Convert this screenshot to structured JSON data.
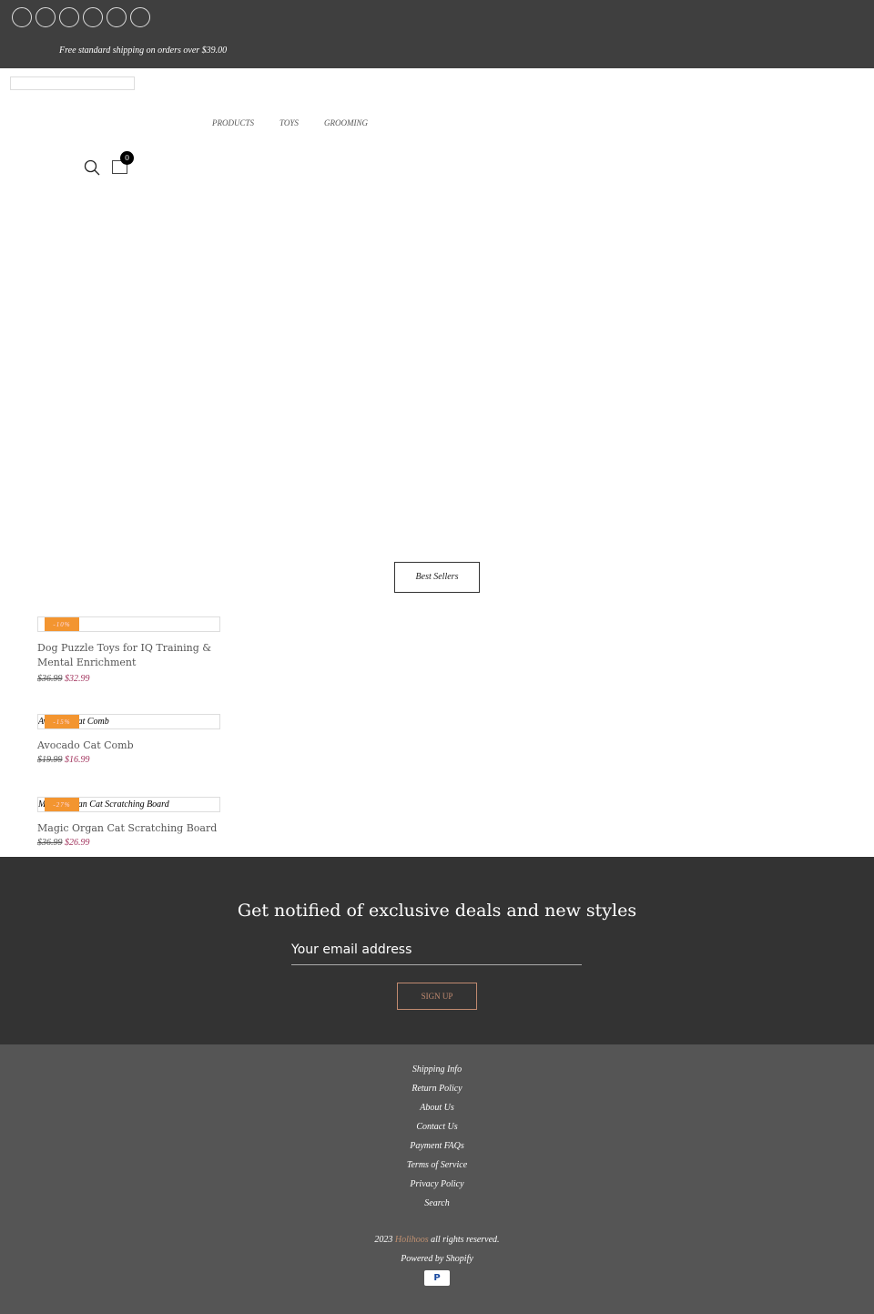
{
  "header": {
    "social_icons": [
      "social-icon-1",
      "social-icon-2",
      "social-icon-3",
      "social-icon-4",
      "social-icon-5",
      "social-icon-6"
    ],
    "shipping_banner": "Free standard shipping on orders over $39.00",
    "nav": [
      "PRODUCTS",
      "TOYS",
      "GROOMING"
    ],
    "cart_count": "0"
  },
  "section": {
    "best_sellers": "Best Sellers"
  },
  "products": [
    {
      "image_alt": "",
      "discount": "-10%",
      "title": "Dog Puzzle Toys for IQ Training & Mental Enrichment",
      "old_price": "$36.99",
      "price": "$32.99"
    },
    {
      "image_alt": "Avocado Cat Comb",
      "discount": "-15%",
      "title": "Avocado Cat Comb",
      "old_price": "$19.99",
      "price": "$16.99"
    },
    {
      "image_alt": "Magic Organ Cat Scratching Board",
      "discount": "-27%",
      "title": "Magic Organ Cat Scratching Board",
      "old_price": "$36.99",
      "price": "$26.99"
    }
  ],
  "newsletter": {
    "heading": "Get notified of exclusive deals and new styles",
    "placeholder": "Your email address",
    "button": "SIGN UP"
  },
  "footer": {
    "links": [
      "Shipping Info",
      "Return Policy",
      "About Us",
      "Contact Us",
      "Payment FAQs",
      "Terms of Service",
      "Privacy Policy",
      "Search"
    ],
    "year": "2023",
    "brand": "Holihoos",
    "rights": "all rights reserved.",
    "powered": "Powered by Shopify",
    "payment": "P"
  },
  "colors": {
    "discount": "#f39530",
    "sale_price": "#a0305a",
    "topbar": "#3f3f3f",
    "newsletter_bg": "#333333",
    "footer_bg": "#555555"
  }
}
